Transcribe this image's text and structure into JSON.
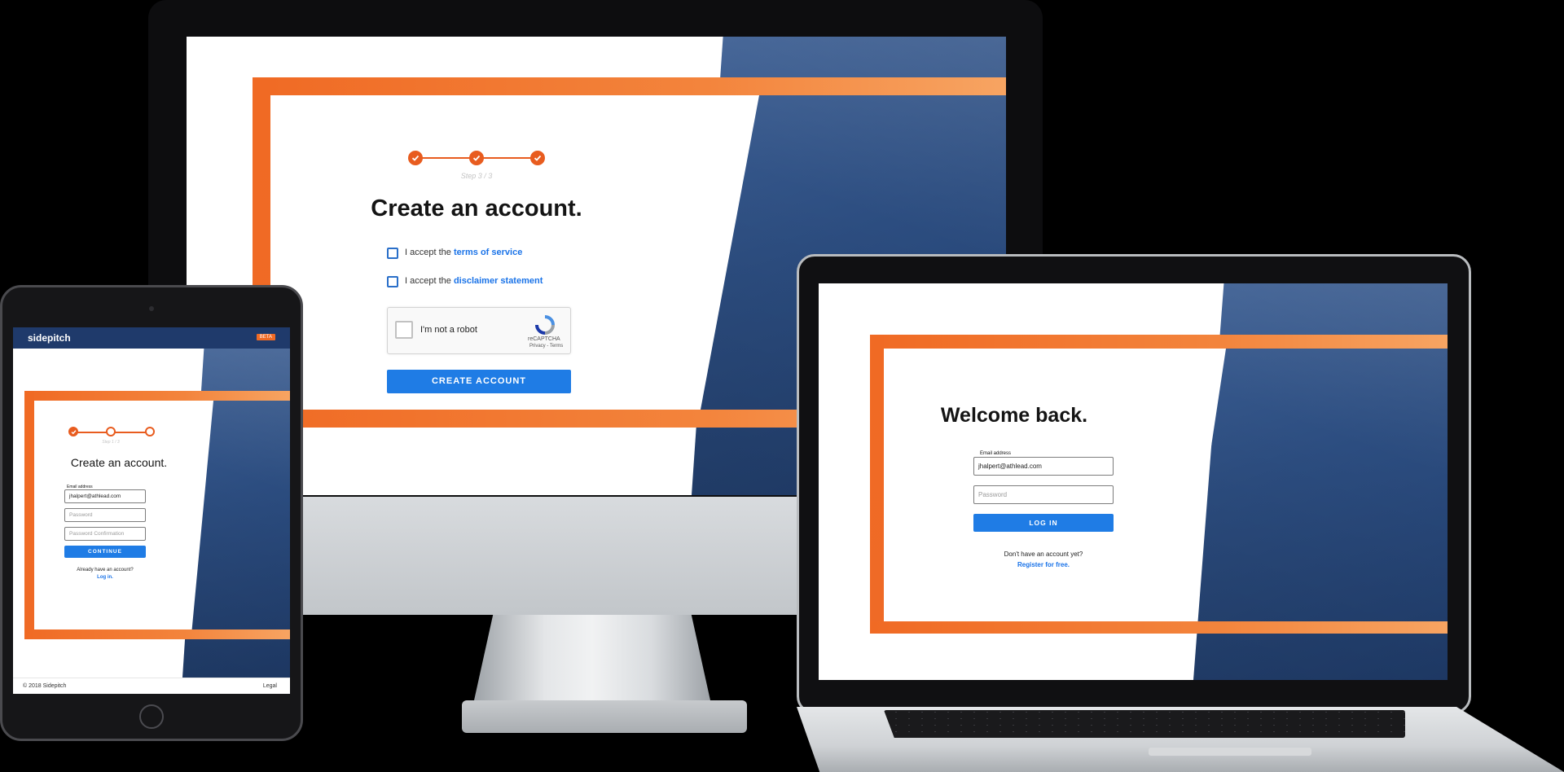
{
  "monitor": {
    "stepper": {
      "step_text": "Step 3 / 3",
      "steps_completed": 3,
      "steps_total": 3
    },
    "title": "Create an account.",
    "terms": {
      "prefix": "I accept the",
      "link": "terms of service"
    },
    "disclaimer": {
      "prefix": "I accept the",
      "link": "disclaimer statement"
    },
    "recaptcha": {
      "label": "I'm not a robot",
      "brand": "reCAPTCHA",
      "footer": "Privacy - Terms"
    },
    "create_button": "CREATE ACCOUNT"
  },
  "tablet": {
    "logo": "sidepitch",
    "beta_badge": "BETA",
    "stepper": {
      "step_text": "Step 1 / 3",
      "steps_completed": 1,
      "steps_total": 3
    },
    "title": "Create an account.",
    "email_label": "Email address",
    "email_value": "jhalpert@athlead.com",
    "password_placeholder": "Password",
    "password_confirm_placeholder": "Password Confirmation",
    "continue_button": "CONTINUE",
    "already_text": "Already have an account?",
    "login_link": "Log in.",
    "copyright": "© 2018 Sidepitch",
    "legal_link": "Legal"
  },
  "laptop": {
    "title": "Welcome back.",
    "email_label": "Email address",
    "email_value": "jhalpert@athlead.com",
    "password_placeholder": "Password",
    "login_button": "LOG IN",
    "no_account_text": "Don't have an account yet?",
    "register_link": "Register for free."
  },
  "colors": {
    "accent_orange": "#f06a24",
    "button_blue": "#1f7ce5",
    "panel_navy": "#2c4d80",
    "link_blue": "#1a73e8"
  },
  "icons": [
    "checkmark-icon",
    "recaptcha-logo-icon"
  ]
}
